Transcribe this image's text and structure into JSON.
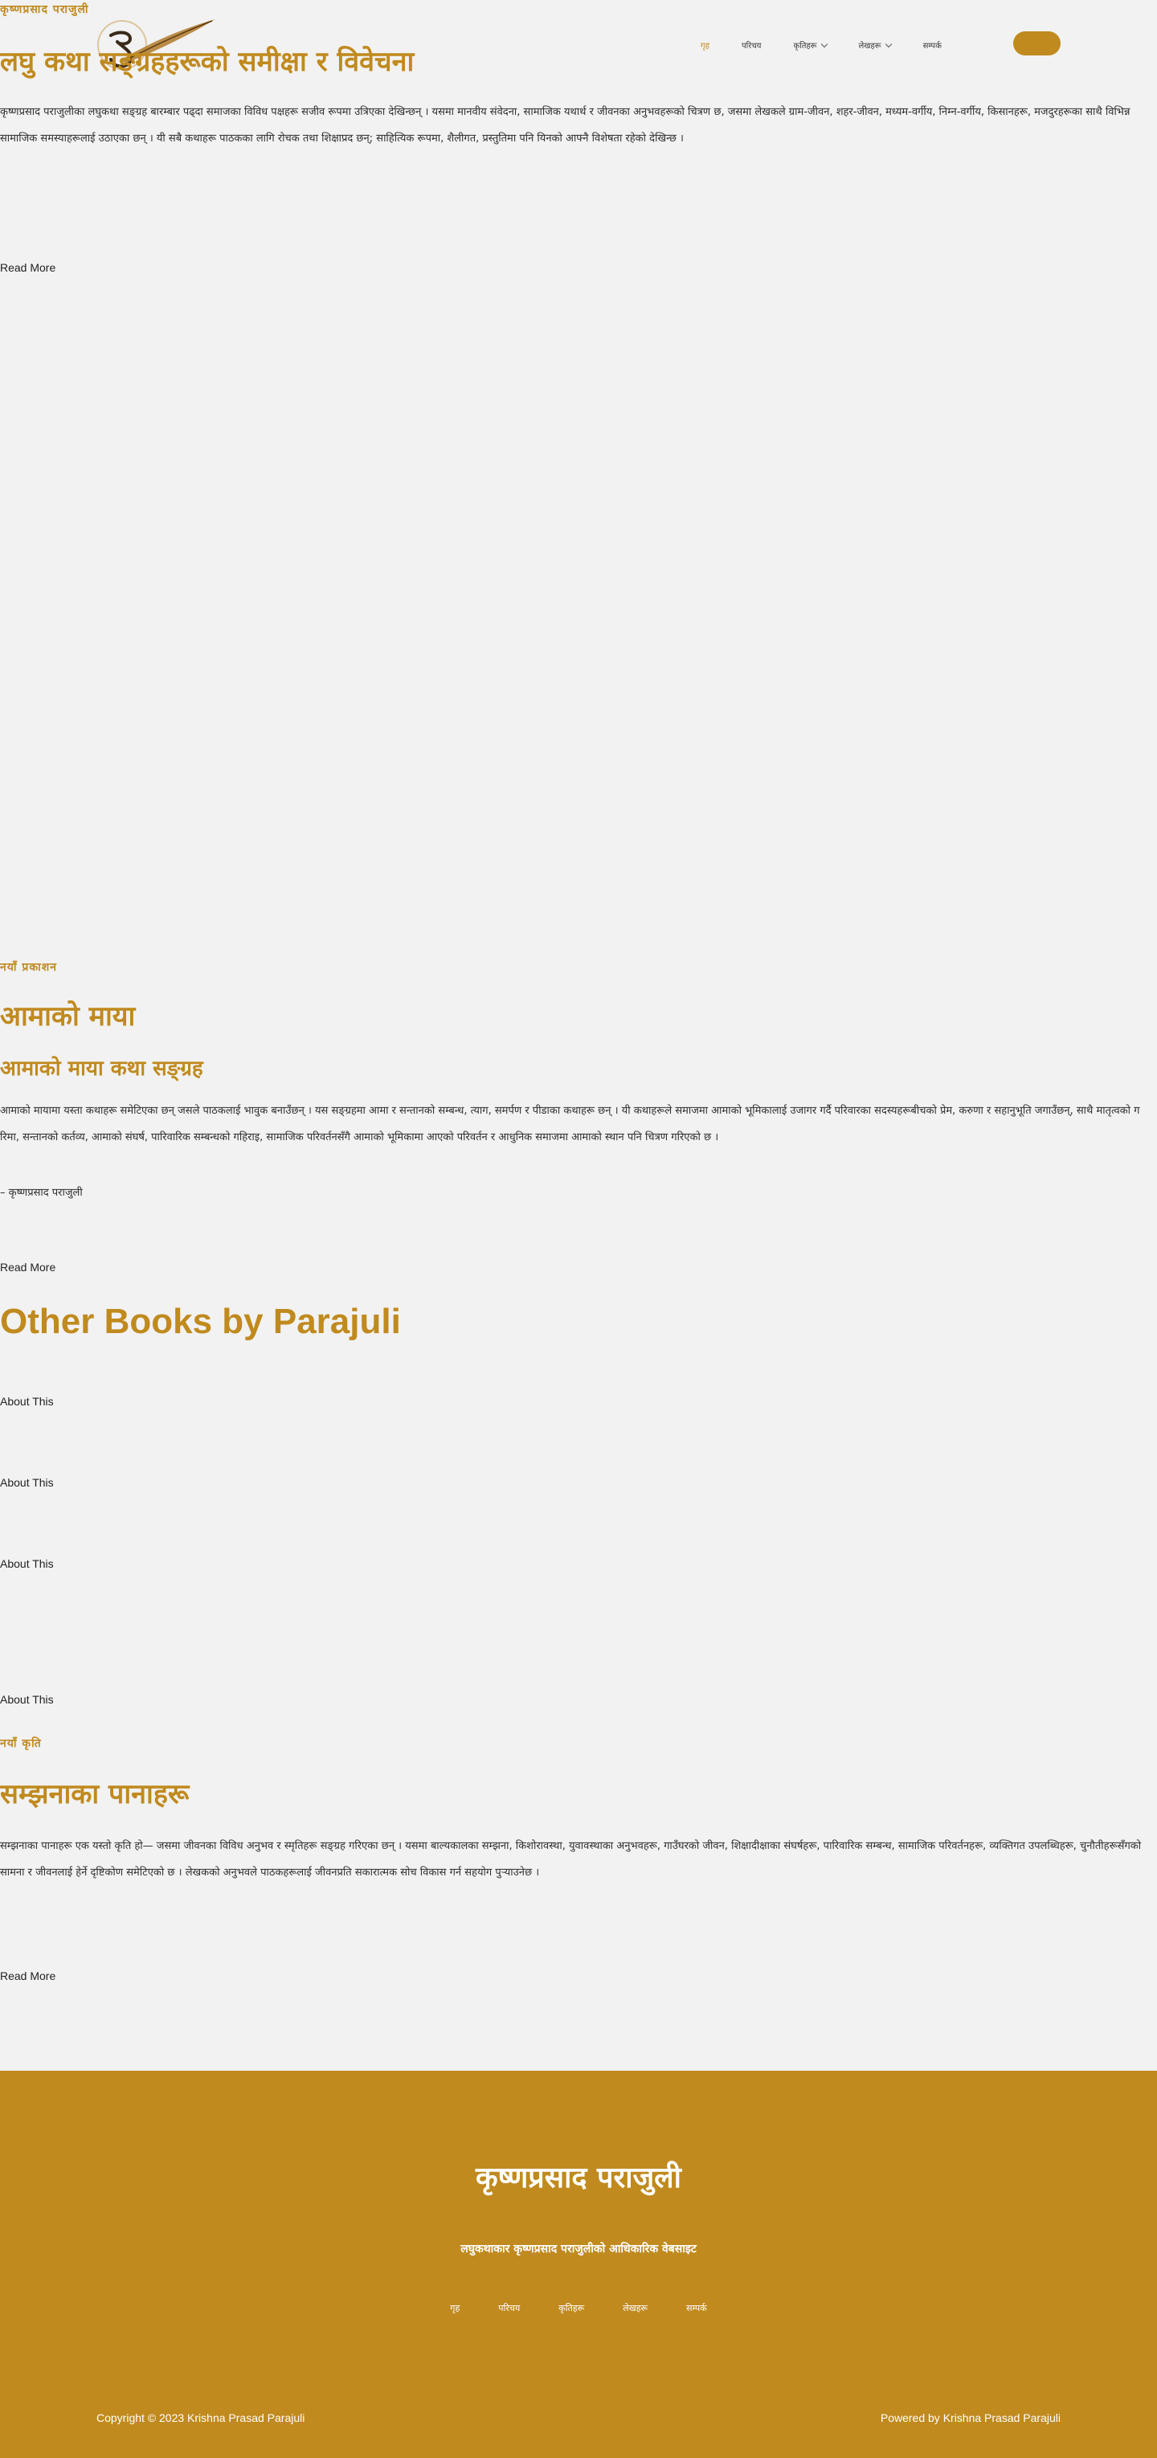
{
  "header": {
    "site_title": "कृष्णप्रसाद पराजुली",
    "nav": [
      {
        "label": "गृह"
      },
      {
        "label": "परिचय"
      },
      {
        "label": "कृतिहरू"
      },
      {
        "label": "लेखहरू"
      },
      {
        "label": "सम्पर्क"
      }
    ],
    "cta_label": ""
  },
  "section1": {
    "title": "लघु कथा सङ्ग्रहहरूको समीक्षा र विवेचना",
    "body": "कृष्णप्रसाद पराजुलीका लघुकथा सङ्ग्रह बारम्बार पढ्दा समाजका विविध पक्षहरू सजीव रूपमा उत्रिएका देखिन्छन् । यसमा मानवीय संवेदना, सामाजिक यथार्थ र जीवनका अनुभवहरूको चित्रण छ, जसमा लेखकले ग्राम-जीवन, शहर-जीवन, मध्यम-वर्गीय, निम्न-वर्गीय, किसानहरू, मजदुरहरूका साथै विभिन्न सामाजिक समस्याहरूलाई उठाएका छन् । यी सबै कथाहरू पाठकका लागि रोचक तथा शिक्षाप्रद छन्; साहित्यिक रूपमा, शैलीगत, प्रस्तुतिमा पनि यिनको आफ्नै विशेषता रहेको देखिन्छ ।",
    "read_more": "Read More"
  },
  "section2": {
    "kicker": "नयाँ प्रकाशन",
    "title": "आमाको माया",
    "subtitle": "आमाको माया कथा सङ्ग्रह",
    "body": "आमाको मायामा यस्ता कथाहरू समेटिएका छन् जसले पाठकलाई भावुक बनाउँछन् । यस सङ्ग्रहमा आमा र सन्तानको सम्बन्ध, त्याग, समर्पण र पीडाका कथाहरू छन् । यी कथाहरूले समाजमा आमाको भूमिकालाई उजागर गर्दै परिवारका सदस्यहरूबीचको प्रेम, करुणा र सहानुभूति जगाउँछन्, साथै मातृत्वको गरिमा, सन्तानको कर्तव्य, आमाको संघर्ष, पारिवारिक सम्बन्धको गहिराइ, सामाजिक परिवर्तनसँगै आमाको भूमिकामा आएको परिवर्तन र आधुनिक समाजमा आमाको स्थान पनि चित्रण गरिएको छ ।",
    "attribution": "– कृष्णप्रसाद पराजुली",
    "read_more": "Read More"
  },
  "other_books": {
    "title": "Other Books by Parajuli",
    "items": [
      {
        "label": "About This"
      },
      {
        "label": "About This"
      },
      {
        "label": "About This"
      },
      {
        "label": "About This"
      }
    ]
  },
  "section3": {
    "kicker": "नयाँ कृति",
    "title": "सम्झनाका पानाहरू",
    "body": "सम्झनाका पानाहरू एक यस्तो कृति हो— जसमा जीवनका विविध अनुभव र स्मृतिहरू सङ्ग्रह गरिएका छन् । यसमा बाल्यकालका सम्झना, किशोरावस्था, युवावस्थाका अनुभवहरू, गाउँघरको जीवन, शिक्षादीक्षाका संघर्षहरू, पारिवारिक सम्बन्ध, सामाजिक परिवर्तनहरू, व्यक्तिगत उपलब्धिहरू, चुनौतीहरूसँगको सामना र जीवनलाई हेर्ने दृष्टिकोण समेटिएको छ । लेखकको अनुभवले पाठकहरूलाई जीवनप्रति सकारात्मक सोच विकास गर्न सहयोग पुर्‍याउनेछ ।",
    "read_more": "Read More"
  },
  "footer": {
    "title": "कृष्णप्रसाद पराजुली",
    "tagline": "लघुकथाकार कृष्णप्रसाद पराजुलीको आधिकारिक वेबसाइट",
    "nav": [
      {
        "label": "गृह"
      },
      {
        "label": "परिचय"
      },
      {
        "label": "कृतिहरू"
      },
      {
        "label": "लेखहरू"
      },
      {
        "label": "सम्पर्क"
      }
    ],
    "copyright": "Copyright © 2023 Krishna Prasad Parajuli",
    "powered_by": "Powered by Krishna Prasad Parajuli"
  },
  "colors": {
    "accent": "#c08a1e",
    "background": "#f2f2f2",
    "text": "#2b2b2b",
    "footer_text": "#ffffff"
  },
  "icons": {
    "logo": "quill-logo-icon",
    "dropdown": "chevron-down-icon"
  }
}
